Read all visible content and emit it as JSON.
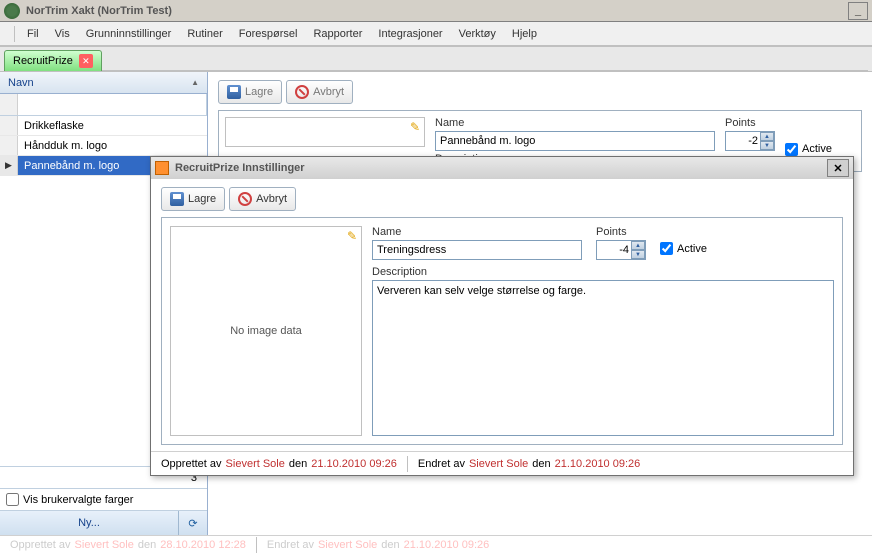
{
  "title": "NorTrim Xakt (NorTrim Test)",
  "menu": [
    "Fil",
    "Vis",
    "Grunninnstillinger",
    "Rutiner",
    "Forespørsel",
    "Rapporter",
    "Integrasjoner",
    "Verktøy",
    "Hjelp"
  ],
  "tab": {
    "label": "RecruitPrize"
  },
  "sidebar": {
    "column": "Navn",
    "rows": [
      "Drikkeflaske",
      "Håndduk m. logo",
      "Pannebånd m. logo"
    ],
    "selected_index": 2,
    "count": "3",
    "user_colors_label": "Vis brukervalgte farger",
    "new_label": "Ny..."
  },
  "main_form": {
    "toolbar": {
      "save": "Lagre",
      "cancel": "Avbryt"
    },
    "name_label": "Name",
    "name_value": "Pannebånd m. logo",
    "points_label": "Points",
    "points_value": "-2",
    "active_label": "Active",
    "desc_label": "Description"
  },
  "modal": {
    "title": "RecruitPrize Innstillinger",
    "toolbar": {
      "save": "Lagre",
      "cancel": "Avbryt"
    },
    "no_image": "No image data",
    "name_label": "Name",
    "name_value": "Treningsdress",
    "points_label": "Points",
    "points_value": "-4",
    "active_label": "Active",
    "desc_label": "Description",
    "desc_value": "Ververen kan selv velge størrelse og farge.",
    "status": {
      "created_by": "Opprettet av",
      "created_user": "Sievert Sole",
      "den1": "den",
      "created_date": "21.10.2010 09:26",
      "modified_by": "Endret av",
      "modified_user": "Sievert Sole",
      "den2": "den",
      "modified_date": "21.10.2010 09:26"
    }
  },
  "bottom": {
    "t1": "Opprettet av",
    "u1": "Sievert Sole",
    "d1": "den",
    "dt1": "28.10.2010 12:28",
    "t2": "Endret av",
    "u2": "Sievert Sole",
    "d2": "den",
    "dt2": "21.10.2010 09:26"
  }
}
